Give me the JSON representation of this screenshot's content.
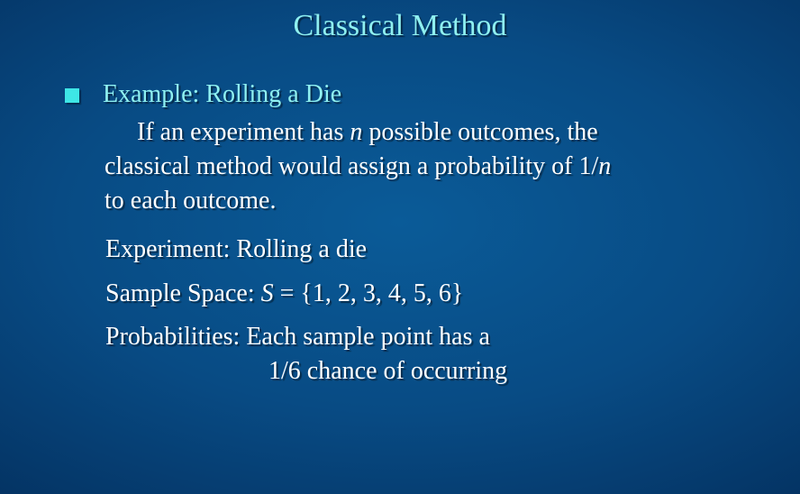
{
  "slide": {
    "title": "Classical Method",
    "example_heading": "Example:  Rolling a Die",
    "definition": {
      "line1_pre": "If an experiment has ",
      "line1_var": "n",
      "line1_post": " possible outcomes, the",
      "line2_pre": "classical method would assign a probability of 1/",
      "line2_var": "n",
      "line3": "to each outcome."
    },
    "experiment": "Experiment:  Rolling a die",
    "sample_space": {
      "label": "Sample Space:  ",
      "var": "S",
      "value": " = {1, 2, 3, 4, 5, 6}"
    },
    "probabilities": {
      "line1": "Probabilities:  Each sample point has a",
      "line2": "1/6 chance of occurring"
    }
  },
  "colors": {
    "title": "#8ff0f0",
    "bullet": "#3ee6e6",
    "body_text": "#ffffff",
    "background_center": "#0a5b98",
    "background_edge": "#032a55"
  }
}
